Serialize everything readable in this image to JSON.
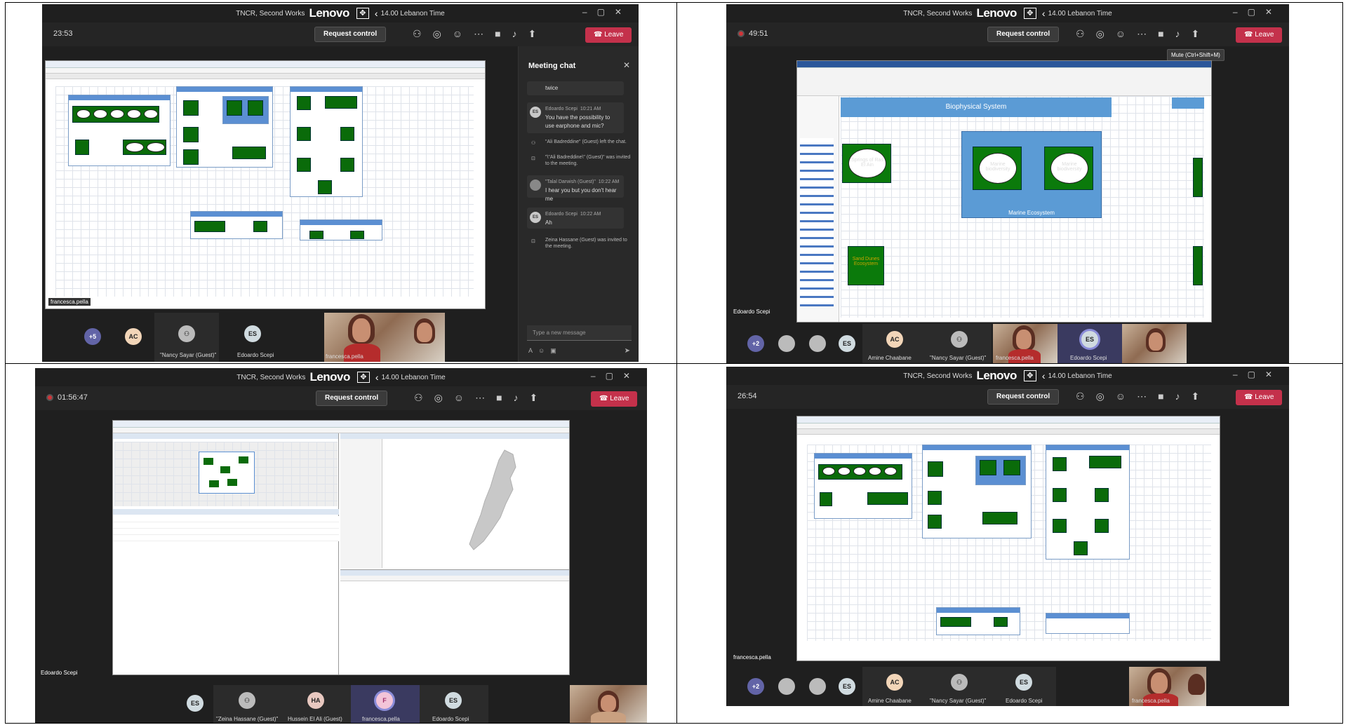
{
  "window": {
    "title_prefix": "TNCR, Second Works",
    "brand": "Lenovo",
    "time_label": "14.00 Lebanon Time"
  },
  "controls": {
    "request_control": "Request control",
    "leave": "Leave"
  },
  "panels": [
    {
      "timer": "23:53",
      "presenter": "francesca.pella",
      "chat": {
        "title": "Meeting chat",
        "messages": [
          {
            "type": "text",
            "text": "twice"
          },
          {
            "type": "msg",
            "author": "Edoardo Scepi",
            "time": "10:21 AM",
            "initials": "ES",
            "text": "You have the possibility to use earphone and mic?"
          },
          {
            "type": "sys",
            "text": "\"Ali Badreddine\" (Guest) left the chat."
          },
          {
            "type": "sys",
            "text": "\"\\\"Ali Badreddine\\\" (Guest)\" was invited to the meeting."
          },
          {
            "type": "msg",
            "author": "\"Talal Darwish (Guest)\"",
            "time": "10:22 AM",
            "initials": "",
            "text": "I hear you but you don't hear me"
          },
          {
            "type": "msg",
            "author": "Edoardo Scepi",
            "time": "10:22 AM",
            "initials": "ES",
            "text": "Ah"
          },
          {
            "type": "sys",
            "text": "Zeina Hassane (Guest) was invited to the meeting."
          }
        ],
        "placeholder": "Type a new message"
      },
      "participants": [
        {
          "initials": "+5",
          "name": ""
        },
        {
          "initials": "AC",
          "name": ""
        },
        {
          "initials": "",
          "name": "\"Nancy Sayar (Guest)\""
        },
        {
          "initials": "ES",
          "name": "Edoardo Scepi"
        },
        {
          "initials": "",
          "name": "francesca.pella"
        }
      ]
    },
    {
      "timer": "49:51",
      "presenter": "Edoardo Scepi",
      "tooltip": "Mute (Ctrl+Shift+M)",
      "diagram": {
        "title": "Biophysical System",
        "springs": "Springs of Ras El Ain",
        "marine1": "Marine biodiversity",
        "marine2": "Marine biodiversity",
        "ecosystem": "Marine Ecosystem",
        "sand": "Sand Dunes Ecosystem"
      },
      "participants": [
        {
          "initials": "+2",
          "name": ""
        },
        {
          "initials": "",
          "name": ""
        },
        {
          "initials": "",
          "name": ""
        },
        {
          "initials": "ES",
          "name": ""
        },
        {
          "initials": "AC",
          "name": "Amine Chaabane"
        },
        {
          "initials": "",
          "name": "\"Nancy Sayar (Guest)\""
        },
        {
          "initials": "",
          "name": "francesca.pella"
        },
        {
          "initials": "ES",
          "name": "Edoardo Scepi"
        }
      ]
    },
    {
      "timer": "01:56:47",
      "presenter": "Edoardo Scepi",
      "participants": [
        {
          "initials": "ES",
          "name": ""
        },
        {
          "initials": "",
          "name": "\"Zeina Hassane (Guest)\""
        },
        {
          "initials": "HA",
          "name": "Hussein El Ali (Guest)"
        },
        {
          "initials": "F",
          "name": "francesca.pella"
        },
        {
          "initials": "ES",
          "name": "Edoardo Scepi"
        }
      ]
    },
    {
      "timer": "26:54",
      "presenter": "francesca.pella",
      "participants": [
        {
          "initials": "+2",
          "name": ""
        },
        {
          "initials": "",
          "name": ""
        },
        {
          "initials": "",
          "name": ""
        },
        {
          "initials": "ES",
          "name": ""
        },
        {
          "initials": "AC",
          "name": "Amine Chaabane"
        },
        {
          "initials": "",
          "name": "\"Nancy Sayar (Guest)\""
        },
        {
          "initials": "ES",
          "name": "Edoardo Scepi"
        },
        {
          "initials": "",
          "name": "francesca.pella"
        }
      ]
    }
  ]
}
